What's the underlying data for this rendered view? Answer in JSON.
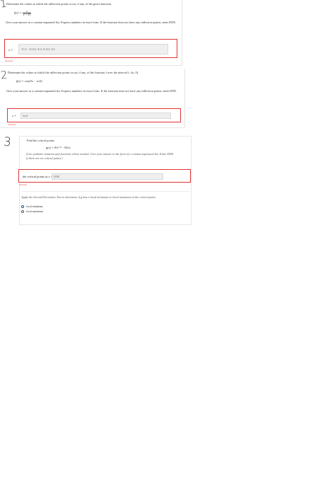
{
  "q1": {
    "hand_number": "1",
    "prompt": "Determine the values at which the inflection points occur, if any, of the given function.",
    "func_lhs": "f(x) =",
    "func_num": "x",
    "func_den": "x² + 81",
    "instructions": "Give your answer as a comma-separated list. Express numbers in exact form. If the function does not have any inflection points, enter DNE.",
    "answer_label": "x =",
    "answer_value": "−9√3, −9√3/2, 9√3, 9√3/2, 0,0",
    "status": "Incorrect"
  },
  "q2": {
    "hand_number": "2",
    "prompt": "Determine the values at which the inflection points occur, if any, of the function f over the interval (−2π, 0).",
    "func": "f(x) = cos(3x − π/2)",
    "instructions": "Give your answer as a comma-separated list. Express numbers in exact form. If the function does not have any inflection points, enter DNE.",
    "answer_label": "x =",
    "answer_value": "2π,0",
    "status": "Incorrect"
  },
  "q3": {
    "hand_number": "3",
    "prompt": "Find the critical points.",
    "func": "g(x) = 4⁵x²ᐟ³ − 95√x",
    "instructions": "(Use symbolic notation and fractions where needed. Give your answer in the form of a comma-separated list. Enter DNE if there are no critical points.)",
    "answer_label": "the critical points at x =",
    "answer_value": "DNE",
    "status": "Incorrect",
    "followup": "Apply the Second Derivative Test to determine if g has a local minimum or local maximum at the critical point.",
    "options": [
      "local minimum",
      "local maximum"
    ]
  }
}
